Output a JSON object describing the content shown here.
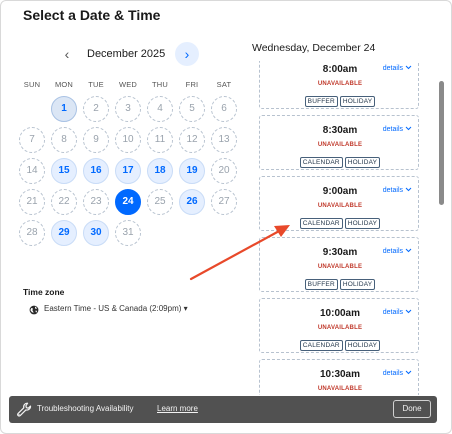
{
  "header": {
    "title": "Select a Date & Time"
  },
  "calendar": {
    "month_label": "December 2025",
    "prev_glyph": "‹",
    "next_glyph": "›",
    "weekdays": [
      "SUN",
      "MON",
      "TUE",
      "WED",
      "THU",
      "FRI",
      "SAT"
    ],
    "days": [
      {
        "n": "1",
        "state": "first"
      },
      {
        "n": "2",
        "state": "open"
      },
      {
        "n": "3",
        "state": "open"
      },
      {
        "n": "4",
        "state": "open"
      },
      {
        "n": "5",
        "state": "open"
      },
      {
        "n": "6",
        "state": "open"
      },
      {
        "n": "7",
        "state": "open"
      },
      {
        "n": "8",
        "state": "open"
      },
      {
        "n": "9",
        "state": "open"
      },
      {
        "n": "10",
        "state": "open"
      },
      {
        "n": "11",
        "state": "open"
      },
      {
        "n": "12",
        "state": "open"
      },
      {
        "n": "13",
        "state": "open"
      },
      {
        "n": "14",
        "state": "open"
      },
      {
        "n": "15",
        "state": "avail"
      },
      {
        "n": "16",
        "state": "avail"
      },
      {
        "n": "17",
        "state": "avail"
      },
      {
        "n": "18",
        "state": "avail"
      },
      {
        "n": "19",
        "state": "avail"
      },
      {
        "n": "20",
        "state": "open"
      },
      {
        "n": "21",
        "state": "open"
      },
      {
        "n": "22",
        "state": "open"
      },
      {
        "n": "23",
        "state": "open"
      },
      {
        "n": "24",
        "state": "selected"
      },
      {
        "n": "25",
        "state": "open"
      },
      {
        "n": "26",
        "state": "avail"
      },
      {
        "n": "27",
        "state": "open"
      },
      {
        "n": "28",
        "state": "open"
      },
      {
        "n": "29",
        "state": "avail"
      },
      {
        "n": "30",
        "state": "avail"
      },
      {
        "n": "31",
        "state": "open"
      }
    ],
    "first_weekday_index": 1
  },
  "timezone": {
    "label": "Time zone",
    "value": "Eastern Time - US & Canada (2:09pm)",
    "caret": "▾"
  },
  "schedule": {
    "date_heading": "Wednesday, December 24",
    "details_label": "details",
    "slots": [
      {
        "time": "8:00am",
        "status": "UNAVAILABLE",
        "tags": [
          "BUFFER",
          "HOLIDAY"
        ]
      },
      {
        "time": "8:30am",
        "status": "UNAVAILABLE",
        "tags": [
          "CALENDAR",
          "HOLIDAY"
        ]
      },
      {
        "time": "9:00am",
        "status": "UNAVAILABLE",
        "tags": [
          "CALENDAR",
          "HOLIDAY"
        ]
      },
      {
        "time": "9:30am",
        "status": "UNAVAILABLE",
        "tags": [
          "BUFFER",
          "HOLIDAY"
        ]
      },
      {
        "time": "10:00am",
        "status": "UNAVAILABLE",
        "tags": [
          "CALENDAR",
          "HOLIDAY"
        ]
      },
      {
        "time": "10:30am",
        "status": "UNAVAILABLE",
        "tags": []
      }
    ]
  },
  "bottom_bar": {
    "text": "Troubleshooting Availability",
    "link": "Learn more",
    "done_label": "Done"
  },
  "colors": {
    "accent": "#0069ff",
    "unavailable": "#c0392b",
    "annotation_arrow": "#e8492a",
    "bottom_bar": "#515151"
  }
}
